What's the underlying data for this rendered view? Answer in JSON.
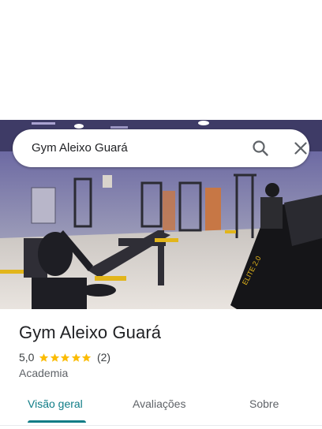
{
  "search": {
    "query": "Gym Aleixo Guará"
  },
  "place": {
    "title": "Gym Aleixo Guará",
    "rating": "5,0",
    "stars": 5,
    "review_count": "(2)",
    "category": "Academia"
  },
  "tabs": [
    {
      "label": "Visão geral",
      "active": true
    },
    {
      "label": "Avaliações",
      "active": false
    },
    {
      "label": "Sobre",
      "active": false
    }
  ],
  "photo": {
    "machine_text": "ELITE 2.0"
  },
  "colors": {
    "accent": "#0e7c86",
    "star": "#fbbc04",
    "text": "#202124",
    "muted": "#5f6368"
  },
  "icons": {
    "search": "search-icon",
    "close": "close-icon"
  }
}
